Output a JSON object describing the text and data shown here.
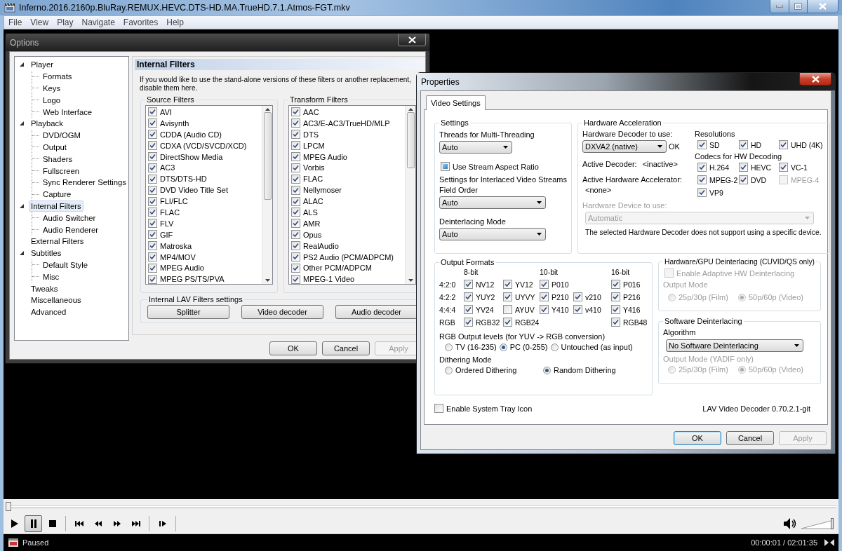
{
  "player": {
    "title": "Inferno.2016.2160p.BluRay.REMUX.HEVC.DTS-HD.MA.TrueHD.7.1.Atmos-FGT.mkv",
    "menu": [
      "File",
      "View",
      "Play",
      "Navigate",
      "Favorites",
      "Help"
    ],
    "seek": {
      "level": 0
    },
    "transport": [
      {
        "kind": "play",
        "pressed": false
      },
      {
        "kind": "pause",
        "pressed": true
      },
      {
        "kind": "stop",
        "pressed": false
      },
      {
        "kind": "previous",
        "pressed": false
      },
      {
        "kind": "rewind",
        "pressed": false
      },
      {
        "kind": "forward",
        "pressed": false
      },
      {
        "kind": "next",
        "pressed": false
      },
      {
        "kind": "frame_step",
        "pressed": false
      }
    ],
    "volume": {
      "level": 1
    },
    "status": "Paused",
    "time": "00:00:01 / 02:01:35"
  },
  "options": {
    "title": "Options",
    "tree": [
      {
        "label": "Player",
        "expanded": true,
        "selected": false,
        "children": [
          {
            "label": "Formats",
            "selected": false
          },
          {
            "label": "Keys",
            "selected": false
          },
          {
            "label": "Logo",
            "selected": false
          },
          {
            "label": "Web Interface",
            "selected": false
          }
        ]
      },
      {
        "label": "Playback",
        "expanded": true,
        "selected": false,
        "children": [
          {
            "label": "DVD/OGM",
            "selected": false
          },
          {
            "label": "Output",
            "selected": false
          },
          {
            "label": "Shaders",
            "selected": false
          },
          {
            "label": "Fullscreen",
            "selected": false
          },
          {
            "label": "Sync Renderer Settings",
            "selected": false
          },
          {
            "label": "Capture",
            "selected": false
          }
        ]
      },
      {
        "label": "Internal Filters",
        "expanded": true,
        "selected": true,
        "children": [
          {
            "label": "Audio Switcher",
            "selected": false
          },
          {
            "label": "Audio Renderer",
            "selected": false
          }
        ]
      },
      {
        "label": "External Filters",
        "selected": false
      },
      {
        "label": "Subtitles",
        "expanded": true,
        "selected": false,
        "children": [
          {
            "label": "Default Style",
            "selected": false
          },
          {
            "label": "Misc",
            "selected": false
          }
        ]
      },
      {
        "label": "Tweaks",
        "selected": false
      },
      {
        "label": "Miscellaneous",
        "selected": false
      },
      {
        "label": "Advanced",
        "selected": false
      }
    ],
    "page_title": "Internal Filters",
    "description": "If you would like to use the stand-alone versions of these filters or another replacement, disable them here.",
    "source_filters": {
      "title": "Source Filters",
      "items": [
        {
          "label": "AVI",
          "checked": true
        },
        {
          "label": "Avisynth",
          "checked": true
        },
        {
          "label": "CDDA (Audio CD)",
          "checked": true
        },
        {
          "label": "CDXA (VCD/SVCD/XCD)",
          "checked": true
        },
        {
          "label": "DirectShow Media",
          "checked": true
        },
        {
          "label": "AC3",
          "checked": true
        },
        {
          "label": "DTS/DTS-HD",
          "checked": true
        },
        {
          "label": "DVD Video Title Set",
          "checked": true
        },
        {
          "label": "FLI/FLC",
          "checked": true
        },
        {
          "label": "FLAC",
          "checked": true
        },
        {
          "label": "FLV",
          "checked": true
        },
        {
          "label": "GIF",
          "checked": true
        },
        {
          "label": "Matroska",
          "checked": true
        },
        {
          "label": "MP4/MOV",
          "checked": true
        },
        {
          "label": "MPEG Audio",
          "checked": true
        },
        {
          "label": "MPEG PS/TS/PVA",
          "checked": true
        }
      ]
    },
    "transform_filters": {
      "title": "Transform Filters",
      "items": [
        {
          "label": "AAC",
          "checked": true
        },
        {
          "label": "AC3/E-AC3/TrueHD/MLP",
          "checked": true
        },
        {
          "label": "DTS",
          "checked": true
        },
        {
          "label": "LPCM",
          "checked": true
        },
        {
          "label": "MPEG Audio",
          "checked": true
        },
        {
          "label": "Vorbis",
          "checked": true
        },
        {
          "label": "FLAC",
          "checked": true
        },
        {
          "label": "Nellymoser",
          "checked": true
        },
        {
          "label": "ALAC",
          "checked": true
        },
        {
          "label": "ALS",
          "checked": true
        },
        {
          "label": "AMR",
          "checked": true
        },
        {
          "label": "Opus",
          "checked": true
        },
        {
          "label": "RealAudio",
          "checked": true
        },
        {
          "label": "PS2 Audio (PCM/ADPCM)",
          "checked": true
        },
        {
          "label": "Other PCM/ADPCM",
          "checked": true
        },
        {
          "label": "MPEG-1 Video",
          "checked": true
        }
      ]
    },
    "lav_settings": {
      "title": "Internal LAV Filters settings",
      "buttons": [
        "Splitter",
        "Video decoder",
        "Audio decoder"
      ]
    },
    "buttons": [
      {
        "label": "OK",
        "disabled": false
      },
      {
        "label": "Cancel",
        "disabled": false
      },
      {
        "label": "Apply",
        "disabled": true
      }
    ]
  },
  "properties": {
    "title": "Properties",
    "tabs": [
      {
        "label": "Video Settings",
        "selected": true
      }
    ],
    "settings": {
      "title": "Settings",
      "threads_label": "Threads for Multi-Threading",
      "threads": "Auto",
      "stream_aspect": {
        "label": "Use Stream Aspect Ratio",
        "checked": false,
        "indeterminate": true
      },
      "interlaced_label": "Settings for Interlaced Video Streams",
      "field_order_label": "Field Order",
      "field_order": "Auto",
      "deint_mode_label": "Deinterlacing Mode",
      "deint_mode": "Auto"
    },
    "hw_accel": {
      "title": "Hardware Acceleration",
      "decoder_label": "Hardware Decoder to use:",
      "decoder": "DXVA2 (native)",
      "decoder_status": "OK",
      "active_decoder_label": "Active Decoder:",
      "active_decoder": "<inactive>",
      "accelerator_label": "Active Hardware Accelerator:",
      "accelerator": "<none>",
      "device_label": "Hardware Device to use:",
      "device": "Automatic",
      "device_disabled": true,
      "note": "The selected Hardware Decoder does not support using a specific device.",
      "resolutions_title": "Resolutions",
      "resolutions": [
        {
          "label": "SD",
          "checked": true,
          "disabled": false
        },
        {
          "label": "HD",
          "checked": true,
          "disabled": false
        },
        {
          "label": "UHD (4K)",
          "checked": true,
          "disabled": false
        }
      ],
      "codecs_title": "Codecs for HW Decoding",
      "codecs": [
        {
          "label": "H.264",
          "checked": true,
          "disabled": false
        },
        {
          "label": "HEVC",
          "checked": true,
          "disabled": false
        },
        {
          "label": "VC-1",
          "checked": true,
          "disabled": false
        },
        {
          "label": "MPEG-2",
          "checked": true,
          "disabled": false
        },
        {
          "label": "DVD",
          "checked": true,
          "disabled": false
        },
        {
          "label": "MPEG-4",
          "checked": false,
          "disabled": true
        },
        {
          "label": "VP9",
          "checked": true,
          "disabled": false
        }
      ]
    },
    "output_formats": {
      "title": "Output Formats",
      "headers": [
        {
          "kind": "header",
          "label": "8-bit"
        },
        {
          "kind": "gap"
        },
        {
          "kind": "header",
          "label": "10-bit"
        },
        {
          "kind": "gap"
        },
        {
          "kind": "header",
          "label": "16-bit"
        }
      ],
      "rows": [
        {
          "label": "4:2:0",
          "formats": [
            {
              "label": "NV12",
              "checked": true
            },
            {
              "label": "YV12",
              "checked": true
            },
            {
              "label": "P010",
              "checked": true
            },
            {
              "kind": "gap"
            },
            {
              "label": "P016",
              "checked": true
            }
          ]
        },
        {
          "label": "4:2:2",
          "formats": [
            {
              "label": "YUY2",
              "checked": true
            },
            {
              "label": "UYVY",
              "checked": true
            },
            {
              "label": "P210",
              "checked": true
            },
            {
              "label": "v210",
              "checked": true
            },
            {
              "label": "P216",
              "checked": true
            }
          ]
        },
        {
          "label": "4:4:4",
          "formats": [
            {
              "label": "YV24",
              "checked": true
            },
            {
              "label": "AYUV",
              "checked": false
            },
            {
              "label": "Y410",
              "checked": true
            },
            {
              "label": "v410",
              "checked": true
            },
            {
              "label": "Y416",
              "checked": true
            }
          ]
        },
        {
          "label": "RGB",
          "formats": [
            {
              "label": "RGB32",
              "checked": true
            },
            {
              "label": "RGB24",
              "checked": true
            },
            {
              "kind": "gap"
            },
            {
              "kind": "gap"
            },
            {
              "label": "RGB48",
              "checked": true
            }
          ]
        }
      ],
      "levels_title": "RGB Output levels (for YUV -> RGB conversion)",
      "levels": [
        {
          "label": "TV (16-235)",
          "selected": false
        },
        {
          "label": "PC (0-255)",
          "selected": true
        },
        {
          "label": "Untouched (as input)",
          "selected": false
        }
      ],
      "dithering_title": "Dithering Mode",
      "dithering": [
        {
          "label": "Ordered Dithering",
          "selected": false
        },
        {
          "label": "Random Dithering",
          "selected": true
        }
      ]
    },
    "hw_deint": {
      "title": "Hardware/GPU Deinterlacing (CUVID/QS only)",
      "adaptive": {
        "label": "Enable Adaptive HW Deinterlacing",
        "checked": false,
        "disabled": true
      },
      "mode_label": "Output Mode",
      "modes": [
        {
          "label": "25p/30p (Film)",
          "selected": false
        },
        {
          "label": "50p/60p (Video)",
          "selected": true
        }
      ],
      "disabled": true
    },
    "sw_deint": {
      "title": "Software Deinterlacing",
      "algorithm_label": "Algorithm",
      "algorithm": "No Software Deinterlacing",
      "mode_label": "Output Mode (YADIF only)",
      "modes": [
        {
          "label": "25p/30p (Film)",
          "selected": false
        },
        {
          "label": "50p/60p (Video)",
          "selected": true
        }
      ],
      "modes_disabled": true
    },
    "tray_icon": {
      "label": "Enable System Tray Icon",
      "checked": false
    },
    "version": "LAV Video Decoder 0.70.2.1-git",
    "buttons": [
      {
        "label": "OK",
        "disabled": false,
        "default": true
      },
      {
        "label": "Cancel",
        "disabled": false,
        "default": false
      },
      {
        "label": "Apply",
        "disabled": true,
        "default": false
      }
    ]
  }
}
